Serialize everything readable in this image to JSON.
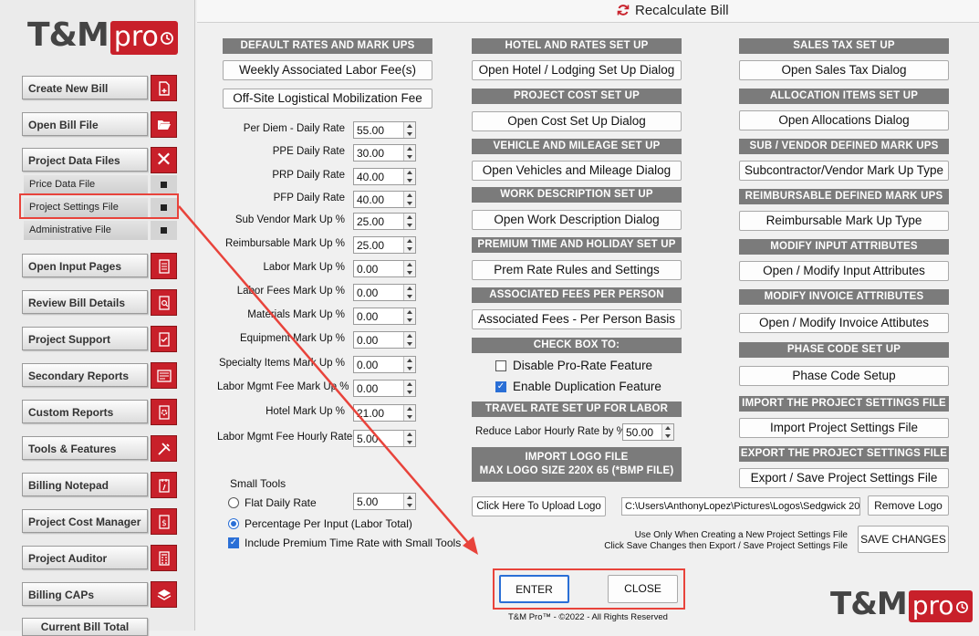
{
  "brand": {
    "name": "T&M",
    "suffix": "pro"
  },
  "titlebar": {
    "icon": "refresh-icon",
    "title": "Recalculate Bill"
  },
  "sidebar": {
    "items": [
      {
        "label": "Create New Bill",
        "icon": "new-file-icon"
      },
      {
        "label": "Open Bill File",
        "icon": "folder-open-icon"
      },
      {
        "label": "Project Data Files",
        "icon": "close-x-icon"
      },
      {
        "label": "Open Input Pages",
        "icon": "document-icon"
      },
      {
        "label": "Review Bill Details",
        "icon": "magnify-document-icon"
      },
      {
        "label": "Project Support",
        "icon": "checklist-icon"
      },
      {
        "label": "Secondary Reports",
        "icon": "report-icon"
      },
      {
        "label": "Custom Reports",
        "icon": "gear-document-icon"
      },
      {
        "label": "Tools & Features",
        "icon": "tools-icon"
      },
      {
        "label": "Billing Notepad",
        "icon": "notepad-icon"
      },
      {
        "label": "Project Cost Manager",
        "icon": "dollar-document-icon"
      },
      {
        "label": "Project Auditor",
        "icon": "calculator-icon"
      },
      {
        "label": "Billing CAPs",
        "icon": "layers-icon"
      },
      {
        "label": "Current Bill Total",
        "icon": ""
      }
    ],
    "subitems": [
      "Price Data File",
      "Project Settings File",
      "Administrative File"
    ]
  },
  "col1": {
    "header": "DEFAULT RATES AND MARK UPS",
    "btn_weekly": "Weekly Associated  Labor Fee(s)",
    "btn_offsite": "Off-Site Logistical Mobilization Fee",
    "rates": [
      {
        "label": "Per Diem - Daily Rate",
        "value": "55.00"
      },
      {
        "label": "PPE Daily Rate",
        "value": "30.00"
      },
      {
        "label": "PRP Daily Rate",
        "value": "40.00"
      },
      {
        "label": "PFP Daily Rate",
        "value": "40.00"
      },
      {
        "label": "Sub Vendor Mark Up %",
        "value": "25.00"
      },
      {
        "label": "Reimbursable Mark Up %",
        "value": "25.00"
      },
      {
        "label": "Labor Mark Up  %",
        "value": "0.00"
      },
      {
        "label": "Labor Fees Mark Up  %",
        "value": "0.00"
      },
      {
        "label": "Materials Mark Up  %",
        "value": "0.00"
      },
      {
        "label": "Equipment Mark Up  %",
        "value": "0.00"
      },
      {
        "label": "Specialty Items Mark Up  %",
        "value": "0.00"
      },
      {
        "label": "Labor Mgmt Fee Mark Up  %",
        "value": "0.00"
      },
      {
        "label": "Hotel Mark Up  %",
        "value": "21.00"
      },
      {
        "label": "Labor Mgmt Fee Hourly Rate",
        "value": "5.00"
      }
    ],
    "small_tools": {
      "title": "Small Tools",
      "flat": "Flat Daily Rate",
      "flat_value": "5.00",
      "percentage": "Percentage Per Input (Labor Total)",
      "include_premium": "Include Premium Time Rate with Small Tools"
    }
  },
  "col2": {
    "sections": [
      {
        "header": "HOTEL AND RATES SET UP",
        "button": "Open Hotel / Lodging Set Up Dialog"
      },
      {
        "header": "PROJECT COST SET UP",
        "button": "Open Cost Set Up Dialog"
      },
      {
        "header": "VEHICLE AND MILEAGE SET UP",
        "button": "Open Vehicles and Mileage Dialog"
      },
      {
        "header": "WORK DESCRIPTION SET UP",
        "button": "Open Work Description Dialog"
      },
      {
        "header": "PREMIUM TIME AND HOLIDAY SET UP",
        "button": "Prem Rate Rules and Settings"
      },
      {
        "header": "ASSOCIATED FEES PER PERSON",
        "button": "Associated Fees  - Per Person Basis"
      }
    ],
    "checkbox_header": "CHECK BOX TO:",
    "chk_prorate": "Disable Pro-Rate Feature",
    "chk_duplication": "Enable Duplication Feature",
    "travel_header": "TRAVEL RATE SET UP FOR LABOR",
    "travel_label": "Reduce Labor Hourly Rate by %",
    "travel_value": "50.00",
    "logo_header_1": "IMPORT LOGO FILE",
    "logo_header_2": "MAX LOGO SIZE 220X 65 (*BMP FILE)",
    "upload_button": "Click Here To Upload Logo",
    "logo_path": "C:\\Users\\AnthonyLopez\\Pictures\\Logos\\Sedgwick 20"
  },
  "col3": {
    "sections": [
      {
        "header": "SALES TAX SET UP",
        "button": "Open Sales Tax Dialog"
      },
      {
        "header": "ALLOCATION ITEMS SET UP",
        "button": "Open Allocations Dialog"
      },
      {
        "header": "SUB / VENDOR DEFINED MARK UPS",
        "button": "Subcontractor/Vendor Mark Up Type"
      },
      {
        "header": "REIMBURSABLE DEFINED MARK UPS",
        "button": "Reimbursable Mark Up Type"
      },
      {
        "header": "MODIFY INPUT ATTRIBUTES",
        "button": "Open / Modify Input Attributes"
      },
      {
        "header": "MODIFY INVOICE ATTRIBUTES",
        "button": "Open / Modify  Invoice Attibutes"
      },
      {
        "header": "PHASE CODE SET UP",
        "button": "Phase Code Setup"
      },
      {
        "header": "IMPORT THE PROJECT SETTINGS FILE",
        "button": "Import Project Settings File"
      },
      {
        "header": "EXPORT THE PROJECT SETTINGS FILE",
        "button": "Export / Save Project  Settings File"
      }
    ],
    "remove_logo": "Remove Logo",
    "note_1": "Use Only When Creating a New Project Settings File",
    "note_2": "Click Save Changes then Export / Save Project Settings File",
    "save_changes": "SAVE CHANGES"
  },
  "footer": {
    "enter": "ENTER",
    "close": "CLOSE",
    "copyright": "T&M Pro™ - ©2022 - All Rights Reserved"
  },
  "colors": {
    "accent": "#c8202a",
    "header_gray": "#7b7b7b",
    "annotation": "#e8433b"
  }
}
